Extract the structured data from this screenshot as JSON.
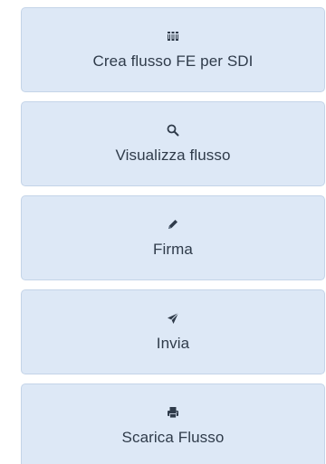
{
  "actions": [
    {
      "label": "Crea flusso FE per SDI",
      "icon": "barcode-icon"
    },
    {
      "label": "Visualizza flusso",
      "icon": "search-icon"
    },
    {
      "label": "Firma",
      "icon": "pencil-icon"
    },
    {
      "label": "Invia",
      "icon": "send-icon"
    },
    {
      "label": "Scarica Flusso",
      "icon": "print-icon"
    }
  ],
  "colors": {
    "button_bg": "#dde8f6",
    "button_border": "#c4d4e8",
    "text": "#2f3b4a",
    "icon": "#2f3b4a"
  }
}
